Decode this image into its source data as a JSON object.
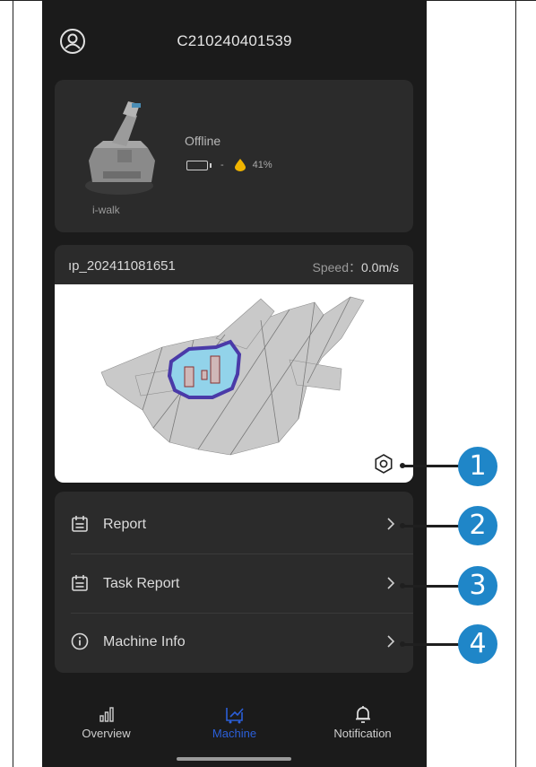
{
  "header": {
    "device_id": "C210240401539",
    "avatar_icon": "user-circle-icon"
  },
  "robot": {
    "name": "i-walk",
    "status": "Offline",
    "battery": "-",
    "water_level": "41%"
  },
  "map": {
    "name": "ıp_202411081651",
    "speed_label": "Speed：",
    "speed_value": "0.0m/s"
  },
  "menu": {
    "items": [
      {
        "label": "Report",
        "icon": "calendar-icon"
      },
      {
        "label": "Task Report",
        "icon": "calendar-icon"
      },
      {
        "label": "Machine Info",
        "icon": "info-icon"
      }
    ]
  },
  "nav": {
    "items": [
      {
        "label": "Overview",
        "icon": "bar-chart-icon"
      },
      {
        "label": "Machine",
        "icon": "machine-icon",
        "active": true
      },
      {
        "label": "Notification",
        "icon": "bell-icon"
      }
    ],
    "active_color": "#2b5fd9"
  },
  "callouts": [
    "1",
    "2",
    "3",
    "4"
  ],
  "colors": {
    "background": "#1b1b1b",
    "card": "#2b2b2b",
    "callout": "#1f86c8",
    "water": "#f0b400"
  }
}
